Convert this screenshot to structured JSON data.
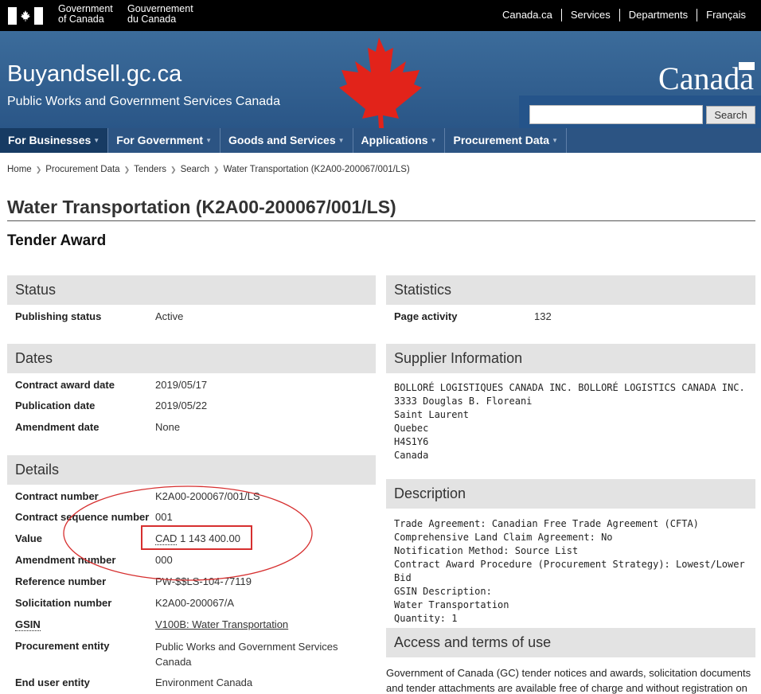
{
  "topbar": {
    "gov_en_line1": "Government",
    "gov_en_line2": "of Canada",
    "gov_fr_line1": "Gouvernement",
    "gov_fr_line2": "du Canada",
    "links": [
      "Canada.ca",
      "Services",
      "Departments",
      "Français"
    ]
  },
  "banner": {
    "site_title": "Buyandsell.gc.ca",
    "site_subtitle": "Public Works and Government Services Canada",
    "wordmark": "Canada",
    "search_button": "Search",
    "search_placeholder": ""
  },
  "nav": {
    "items": [
      "For Businesses",
      "For Government",
      "Goods and Services",
      "Applications",
      "Procurement Data"
    ]
  },
  "breadcrumb": [
    "Home",
    "Procurement Data",
    "Tenders",
    "Search",
    "Water Transportation (K2A00-200067/001/LS)"
  ],
  "page": {
    "title": "Water Transportation (K2A00-200067/001/LS)",
    "subtitle": "Tender Award"
  },
  "status": {
    "heading": "Status",
    "publishing_status_label": "Publishing status",
    "publishing_status_value": "Active"
  },
  "dates": {
    "heading": "Dates",
    "rows": [
      {
        "label": "Contract award date",
        "value": "2019/05/17"
      },
      {
        "label": "Publication date",
        "value": "2019/05/22"
      },
      {
        "label": "Amendment date",
        "value": "None"
      }
    ]
  },
  "details": {
    "heading": "Details",
    "contract_number_label": "Contract number",
    "contract_number": "K2A00-200067/001/LS",
    "sequence_label": "Contract sequence number",
    "sequence": "001",
    "value_label": "Value",
    "value_currency": "CAD",
    "value_amount": "1 143 400.00",
    "amendment_label": "Amendment number",
    "amendment": "000",
    "reference_label": "Reference number",
    "reference": "PW-$$LS-104-77119",
    "solicitation_label": "Solicitation number",
    "solicitation": "K2A00-200067/A",
    "gsin_label": "GSIN",
    "gsin": "V100B: Water Transportation",
    "procurement_entity_label": "Procurement entity",
    "procurement_entity_line1": "Public Works and Government Services",
    "procurement_entity_line2": "Canada",
    "end_user_label": "End user entity",
    "end_user": "Environment Canada"
  },
  "statistics": {
    "heading": "Statistics",
    "page_activity_label": "Page activity",
    "page_activity": "132"
  },
  "supplier": {
    "heading": "Supplier Information",
    "lines": [
      "BOLLORÉ LOGISTIQUES CANADA INC. BOLLORÉ LOGISTICS CANADA INC.",
      "3333 Douglas B. Floreani",
      "Saint Laurent",
      "Quebec",
      "H4S1Y6",
      "Canada"
    ]
  },
  "description": {
    "heading": "Description",
    "lines": [
      "Trade Agreement: Canadian Free Trade Agreement (CFTA)",
      "Comprehensive Land Claim Agreement: No",
      "Notification Method: Source List",
      "Contract Award Procedure (Procurement Strategy): Lowest/Lower Bid",
      "GSIN Description:",
      "Water Transportation",
      "Quantity: 1"
    ]
  },
  "access": {
    "heading": "Access and terms of use",
    "text_line1": "Government of Canada (GC) tender notices and awards, solicitation documents",
    "text_line2": "and tender attachments are available free of charge and without registration on"
  },
  "colors": {
    "nav_bg": "#2c5483",
    "banner_bg": "#2a5687",
    "panel_bg": "#e3e3e3",
    "annotation_red": "#d62f2f",
    "maple_red": "#e2231a"
  }
}
